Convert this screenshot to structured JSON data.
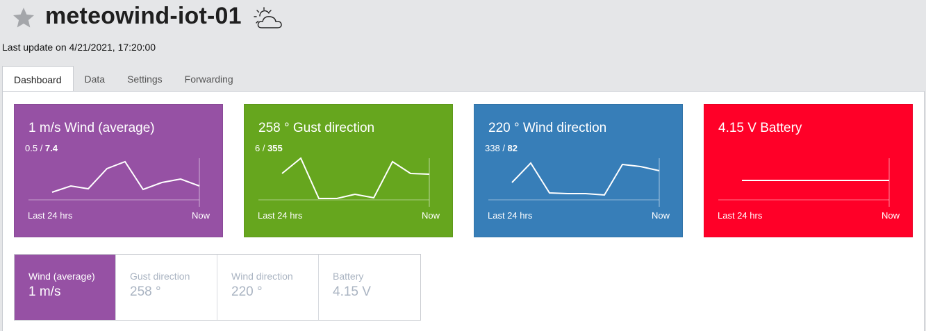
{
  "header": {
    "title": "meteowind-iot-01",
    "star_icon": "star-icon",
    "weather_icon": "partly-cloudy-icon",
    "last_update": "Last update on 4/21/2021, 17:20:00"
  },
  "tabs": [
    {
      "label": "Dashboard",
      "active": true
    },
    {
      "label": "Data",
      "active": false
    },
    {
      "label": "Settings",
      "active": false
    },
    {
      "label": "Forwarding",
      "active": false
    }
  ],
  "cards": [
    {
      "title": "1 m/s Wind (average)",
      "min": "0.5",
      "max": "7.4",
      "left_label": "Last 24 hrs",
      "right_label": "Now",
      "color": "#9651a4"
    },
    {
      "title": "258 ° Gust direction",
      "min": "6",
      "max": "355",
      "left_label": "Last 24 hrs",
      "right_label": "Now",
      "color": "#66a61e"
    },
    {
      "title": "220 ° Wind direction",
      "min": "338",
      "max": "82",
      "left_label": "Last 24 hrs",
      "right_label": "Now",
      "color": "#377eb8"
    },
    {
      "title": "4.15 V Battery",
      "min": "",
      "max": "",
      "left_label": "Last 24 hrs",
      "right_label": "Now",
      "color": "#ff0028"
    }
  ],
  "selector": [
    {
      "label": "Wind (average)",
      "value": "1 m/s",
      "active": true
    },
    {
      "label": "Gust direction",
      "value": "258 °",
      "active": false
    },
    {
      "label": "Wind direction",
      "value": "220 °",
      "active": false
    },
    {
      "label": "Battery",
      "value": "4.15 V",
      "active": false
    }
  ]
}
